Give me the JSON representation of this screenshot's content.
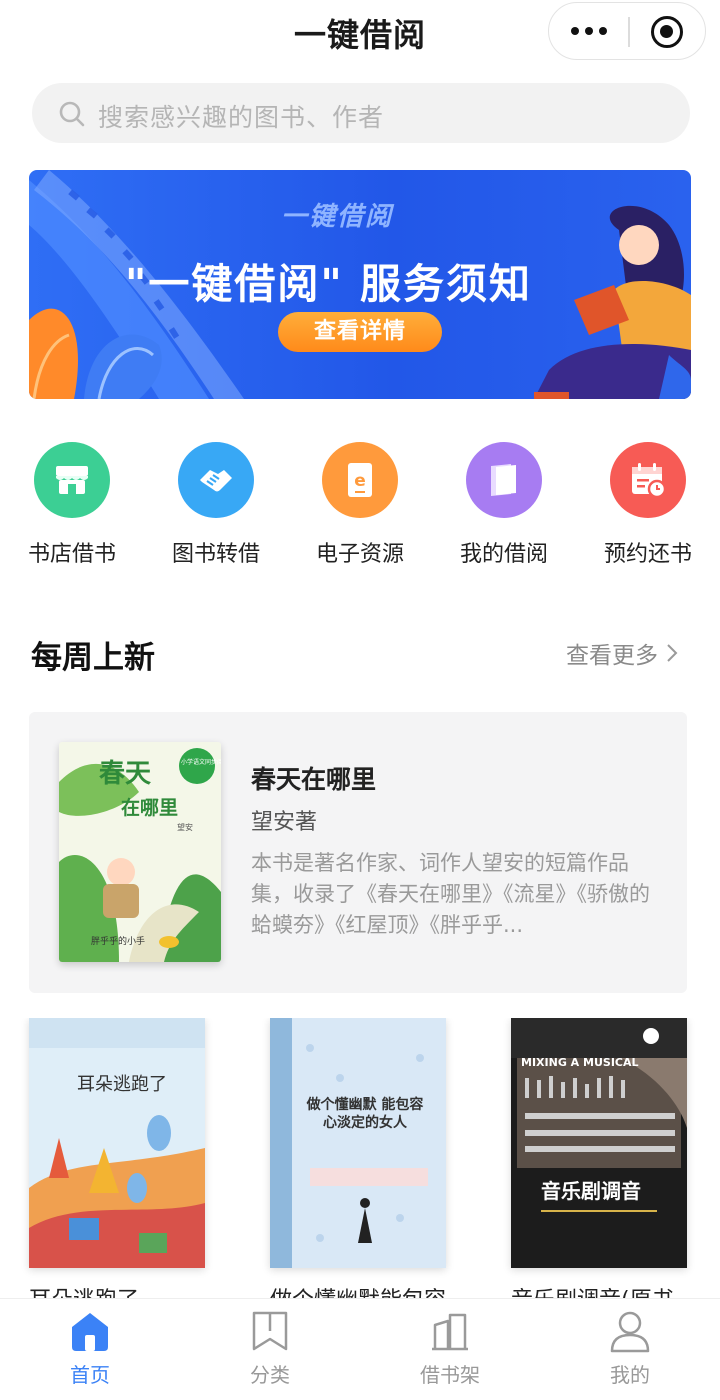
{
  "app": {
    "title": "一键借阅",
    "accent_color": "#3b82f6"
  },
  "search": {
    "placeholder": "搜索感兴趣的图书、作者"
  },
  "banner": {
    "logo_text": "一键借阅",
    "headline": "\"一键借阅\" 服务须知",
    "button_label": "查看详情"
  },
  "entries": [
    {
      "label": "书店借书",
      "icon": "store-icon",
      "color": "#3ccf94"
    },
    {
      "label": "图书转借",
      "icon": "handshake-icon",
      "color": "#38a8f5"
    },
    {
      "label": "电子资源",
      "icon": "ebook-icon",
      "color": "#ff9a3c"
    },
    {
      "label": "我的借阅",
      "icon": "book-icon",
      "color": "#a77cf2"
    },
    {
      "label": "预约还书",
      "icon": "calendar-clock-icon",
      "color": "#f75b55"
    }
  ],
  "weekly": {
    "title": "每周上新",
    "more_label": "查看更多"
  },
  "featured": {
    "title": "春天在哪里",
    "author": "望安著",
    "description": "本书是著名作家、词作人望安的短篇作品集，收录了《春天在哪里》《流星》《骄傲的蛤蟆夯》《红屋顶》《胖乎乎...",
    "cover": {
      "title_line1": "春天",
      "title_line2": "在哪里",
      "author": "望安",
      "series": "小学语文同步阅读",
      "subtitle": "胖乎乎的小手"
    }
  },
  "books": [
    {
      "title": "耳朵逃跑了",
      "cover_text": "耳朵逃跑了"
    },
    {
      "title": "做个懂幽默能包容",
      "cover_text": "做个懂幽默 能包容 心淡定的女人"
    },
    {
      "title": "音乐剧调音(原书",
      "cover_text": "音乐剧调音",
      "cover_en": "MIXING A MUSICAL"
    }
  ],
  "tabbar": [
    {
      "label": "首页",
      "icon": "home-icon",
      "active": true
    },
    {
      "label": "分类",
      "icon": "bookmark-icon",
      "active": false
    },
    {
      "label": "借书架",
      "icon": "bookshelf-icon",
      "active": false
    },
    {
      "label": "我的",
      "icon": "user-icon",
      "active": false
    }
  ]
}
